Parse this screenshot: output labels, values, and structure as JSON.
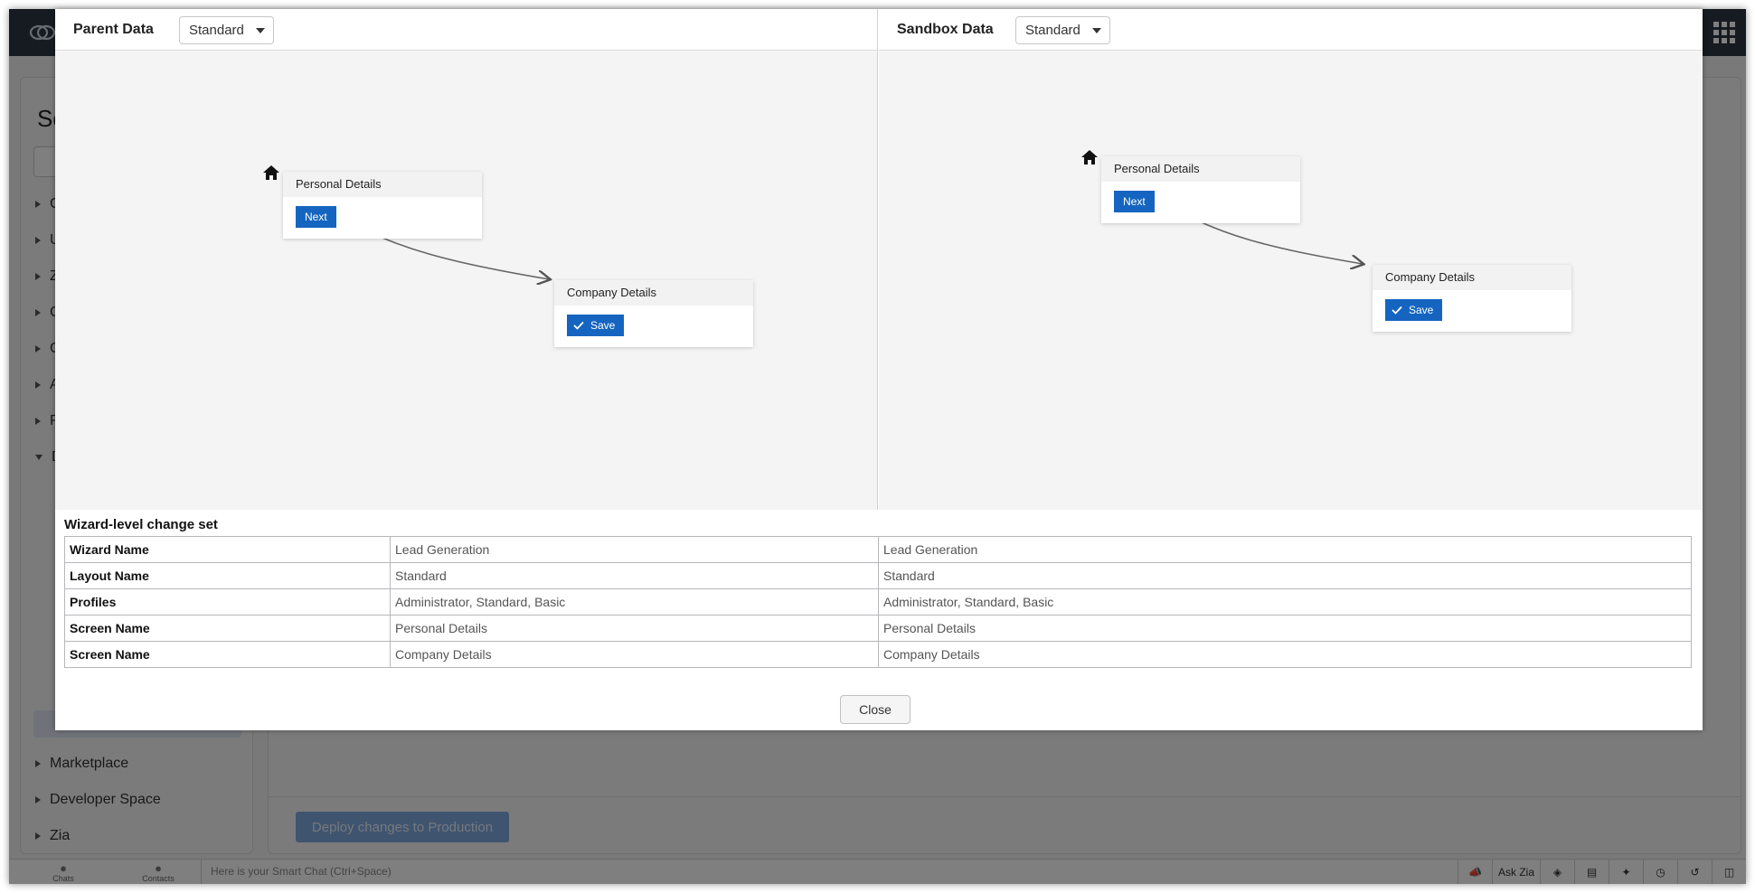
{
  "sidebar": {
    "title_partial": "Set",
    "items": [
      {
        "label": "Ge"
      },
      {
        "label": "Us"
      },
      {
        "label": "Zo"
      },
      {
        "label": "Ch"
      },
      {
        "label": "Cu"
      },
      {
        "label": "Au"
      },
      {
        "label": "Pr"
      },
      {
        "label": "Da"
      },
      {
        "label": "Marketplace"
      },
      {
        "label": "Developer Space"
      },
      {
        "label": "Zia"
      }
    ]
  },
  "content": {
    "deploy_button": "Deploy changes to Production"
  },
  "chatbar": {
    "chats_label": "Chats",
    "contacts_label": "Contacts",
    "smart_chat_placeholder": "Here is your Smart Chat (Ctrl+Space)",
    "ask_zia": "Ask Zia"
  },
  "modal": {
    "parent": {
      "title": "Parent Data",
      "layout_selected": "Standard",
      "screens": [
        {
          "name": "Personal Details",
          "button": "Next"
        },
        {
          "name": "Company Details",
          "button": "Save"
        }
      ]
    },
    "sandbox": {
      "title": "Sandbox Data",
      "layout_selected": "Standard",
      "screens": [
        {
          "name": "Personal Details",
          "button": "Next"
        },
        {
          "name": "Company Details",
          "button": "Save"
        }
      ]
    },
    "change_set": {
      "title": "Wizard-level change set",
      "rows": [
        {
          "label": "Wizard Name",
          "parent": "Lead Generation",
          "sandbox": "Lead Generation"
        },
        {
          "label": "Layout Name",
          "parent": "Standard",
          "sandbox": "Standard"
        },
        {
          "label": "Profiles",
          "parent": "Administrator, Standard, Basic",
          "sandbox": "Administrator, Standard, Basic"
        },
        {
          "label": "Screen Name",
          "parent": "Personal Details",
          "sandbox": "Personal Details"
        },
        {
          "label": "Screen Name",
          "parent": "Company Details",
          "sandbox": "Company Details"
        }
      ]
    },
    "close_button": "Close"
  },
  "colors": {
    "primary_button": "#1565c0",
    "topbar": "#2d3645"
  }
}
